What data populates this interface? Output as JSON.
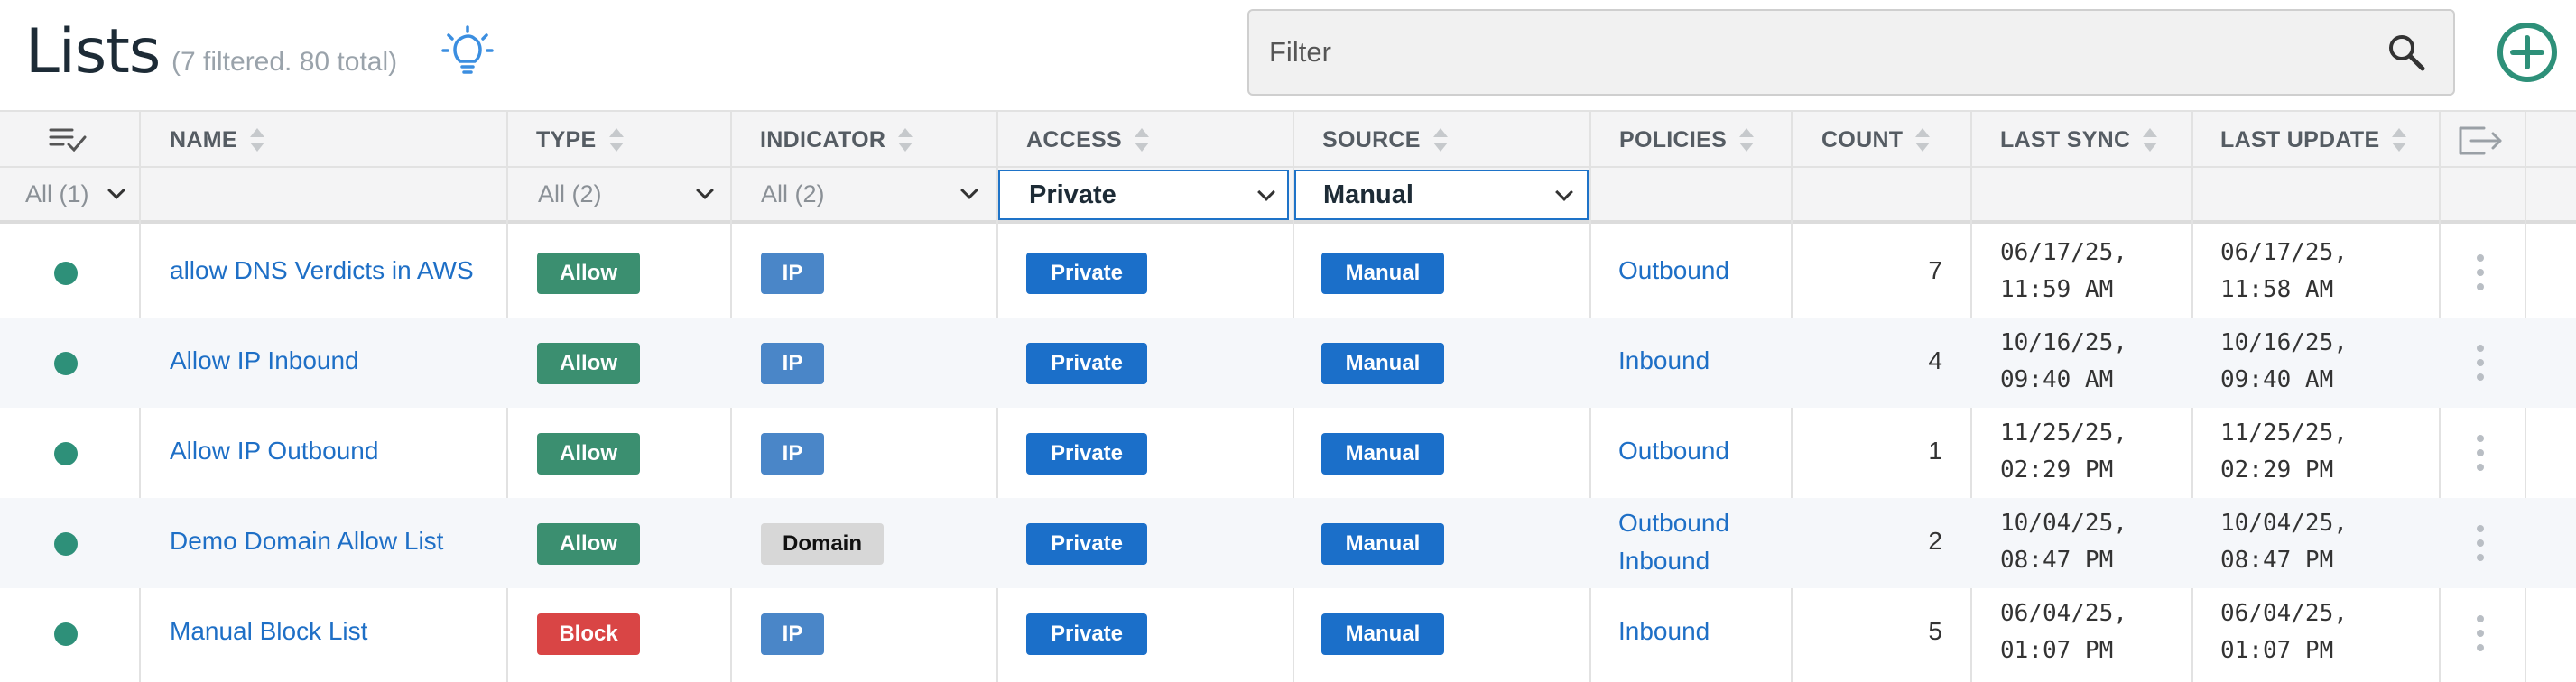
{
  "header": {
    "title": "Lists",
    "subtitle": "(7 filtered. 80 total)",
    "filter_placeholder": "Filter"
  },
  "icons": {
    "tips": "lightbulb-icon",
    "search": "search-icon",
    "add": "add-circle-icon",
    "column_chooser": "column-chooser-icon",
    "export": "export-icon",
    "row_menu": "kebab-menu-icon"
  },
  "colors": {
    "accent": "#1b6fc9",
    "allow": "#3b8f70",
    "block": "#d94545",
    "ip": "#4a86c8",
    "status_active": "#2e9079",
    "link": "#1e6fc6"
  },
  "columns": [
    {
      "key": "status",
      "label": ""
    },
    {
      "key": "name",
      "label": "NAME"
    },
    {
      "key": "type",
      "label": "TYPE"
    },
    {
      "key": "indicator",
      "label": "INDICATOR"
    },
    {
      "key": "access",
      "label": "ACCESS"
    },
    {
      "key": "source",
      "label": "SOURCE"
    },
    {
      "key": "policies",
      "label": "POLICIES"
    },
    {
      "key": "count",
      "label": "COUNT"
    },
    {
      "key": "last_sync",
      "label": "LAST SYNC"
    },
    {
      "key": "last_update",
      "label": "LAST UPDATE"
    }
  ],
  "filters": {
    "status": "All (1)",
    "type": "All (2)",
    "indicator": "All (2)",
    "access": "Private",
    "source": "Manual"
  },
  "rows": [
    {
      "name": "allow DNS Verdicts in AWS",
      "type": "Allow",
      "indicator": "IP",
      "access": "Private",
      "source": "Manual",
      "policies": [
        "Outbound"
      ],
      "count": "7",
      "last_sync": "06/17/25,\n11:59 AM",
      "last_update": "06/17/25,\n11:58 AM"
    },
    {
      "name": "Allow IP Inbound",
      "type": "Allow",
      "indicator": "IP",
      "access": "Private",
      "source": "Manual",
      "policies": [
        "Inbound"
      ],
      "count": "4",
      "last_sync": "10/16/25,\n09:40 AM",
      "last_update": "10/16/25,\n09:40 AM"
    },
    {
      "name": "Allow IP Outbound",
      "type": "Allow",
      "indicator": "IP",
      "access": "Private",
      "source": "Manual",
      "policies": [
        "Outbound"
      ],
      "count": "1",
      "last_sync": "11/25/25,\n02:29 PM",
      "last_update": "11/25/25,\n02:29 PM"
    },
    {
      "name": "Demo Domain Allow List",
      "type": "Allow",
      "indicator": "Domain",
      "access": "Private",
      "source": "Manual",
      "policies": [
        "Outbound",
        "Inbound"
      ],
      "count": "2",
      "last_sync": "10/04/25,\n08:47 PM",
      "last_update": "10/04/25,\n08:47 PM"
    },
    {
      "name": "Manual Block List",
      "type": "Block",
      "indicator": "IP",
      "access": "Private",
      "source": "Manual",
      "policies": [
        "Inbound"
      ],
      "count": "5",
      "last_sync": "06/04/25,\n01:07 PM",
      "last_update": "06/04/25,\n01:07 PM"
    }
  ]
}
